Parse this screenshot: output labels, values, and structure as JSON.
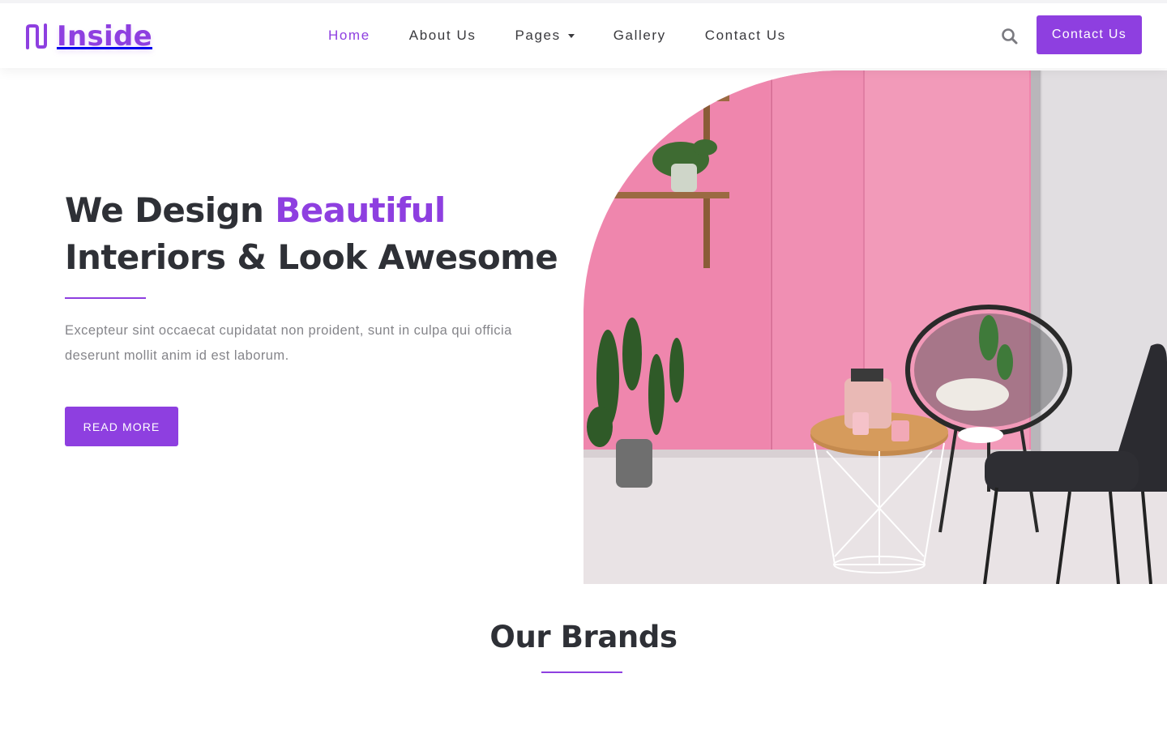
{
  "brand": {
    "name": "Inside",
    "logo_icon": "double-n-logo-icon",
    "color": "#8e3fe0"
  },
  "nav": {
    "items": [
      {
        "label": "Home",
        "active": true
      },
      {
        "label": "About Us",
        "active": false
      },
      {
        "label": "Pages",
        "active": false,
        "dropdown": true
      },
      {
        "label": "Gallery",
        "active": false
      },
      {
        "label": "Contact Us",
        "active": false
      }
    ],
    "search_icon": "search-icon",
    "cta_label": "Contact Us"
  },
  "hero": {
    "title_part1": "We Design ",
    "title_accent": "Beautiful",
    "title_part2": "Interiors & Look Awesome",
    "description": "Excepteur sint occaecat cupidatat non proident, sunt in culpa qui officia deserunt mollit anim id est laborum.",
    "button_label": "READ MORE"
  },
  "brands": {
    "title": "Our Brands"
  },
  "colors": {
    "accent": "#8e3fe0",
    "heading": "#2e3036",
    "body_text": "#85858a",
    "wall_pink": "#ec7da6"
  }
}
